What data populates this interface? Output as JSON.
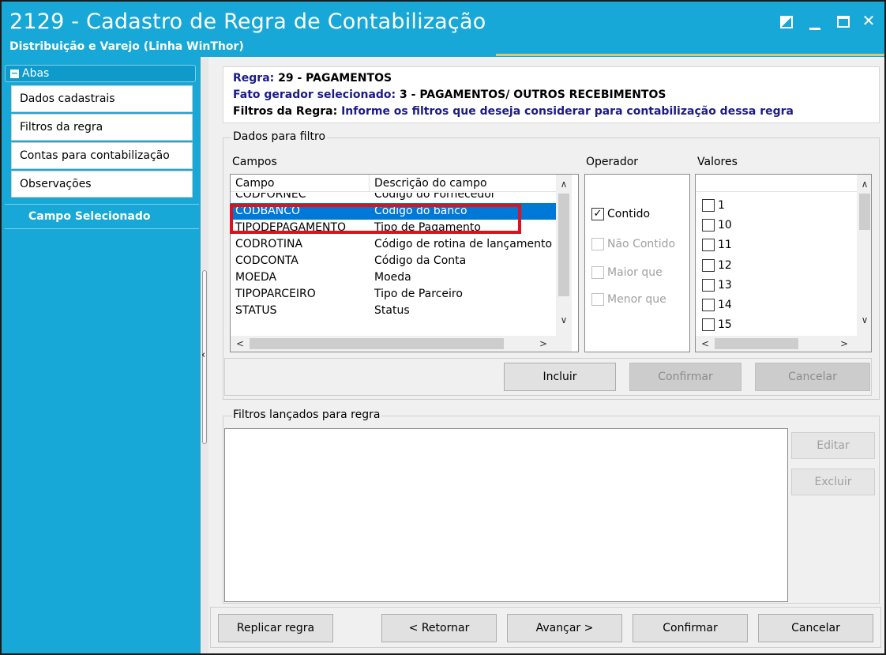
{
  "window": {
    "title": "2129 - Cadastro de Regra de Contabilização",
    "subtitle": "Distribuição e Varejo (Linha WinThor)",
    "close_glyph": "✕",
    "colors": {
      "titlebar": "#17a8d8",
      "selection": "#0078d7",
      "highlight": "#e0111c"
    }
  },
  "sidebar": {
    "header": "Abas",
    "items": [
      {
        "label": "Dados cadastrais"
      },
      {
        "label": "Filtros da regra"
      },
      {
        "label": "Contas para contabilização"
      },
      {
        "label": "Observações"
      }
    ],
    "section": "Campo Selecionado"
  },
  "info": {
    "regra_label": "Regra:",
    "regra_value": "29 - PAGAMENTOS",
    "fato_label": "Fato gerador selecionado:",
    "fato_value": "3 - PAGAMENTOS/ OUTROS RECEBIMENTOS",
    "filtros_label": "Filtros da Regra:",
    "filtros_value": "Informe os filtros que deseja considerar para contabilização dessa regra"
  },
  "dados_filtro": {
    "group_title": "Dados para filtro",
    "campos_label": "Campos",
    "operador_label": "Operador",
    "valores_label": "Valores",
    "columns": [
      "Campo",
      "Descrição do campo"
    ],
    "rows": [
      {
        "campo": "CODFORNEC",
        "descricao": "Código do Fornecedor"
      },
      {
        "campo": "CODBANCO",
        "descricao": "Código do banco"
      },
      {
        "campo": "TIPODEPAGAMENTO",
        "descricao": "Tipo de Pagamento"
      },
      {
        "campo": "CODROTINA",
        "descricao": "Código de rotina de lançamento"
      },
      {
        "campo": "CODCONTA",
        "descricao": "Código da Conta"
      },
      {
        "campo": "MOEDA",
        "descricao": "Moeda"
      },
      {
        "campo": "TIPOPARCEIRO",
        "descricao": "Tipo de Parceiro"
      },
      {
        "campo": "STATUS",
        "descricao": "Status"
      }
    ],
    "selected_campo": "CODBANCO",
    "operadores": [
      {
        "label": "Contido",
        "checked": true,
        "enabled": true
      },
      {
        "label": "Não Contido",
        "checked": false,
        "enabled": false
      },
      {
        "label": "Maior que",
        "checked": false,
        "enabled": false
      },
      {
        "label": "Menor que",
        "checked": false,
        "enabled": false
      }
    ],
    "valores": [
      "1",
      "10",
      "11",
      "12",
      "13",
      "14",
      "15"
    ],
    "buttons": {
      "incluir": "Incluir",
      "confirmar": "Confirmar",
      "cancelar": "Cancelar"
    }
  },
  "filtros_lancados": {
    "group_title": "Filtros lançados para regra",
    "editar": "Editar",
    "excluir": "Excluir"
  },
  "footer": {
    "replicar": "Replicar regra",
    "retornar": "< Retornar",
    "avancar": "Avançar >",
    "confirmar": "Confirmar",
    "cancelar": "Cancelar"
  },
  "scroll_glyphs": {
    "up": "∧",
    "down": "∨",
    "left": "<",
    "right": ">",
    "splitter": "‹"
  }
}
